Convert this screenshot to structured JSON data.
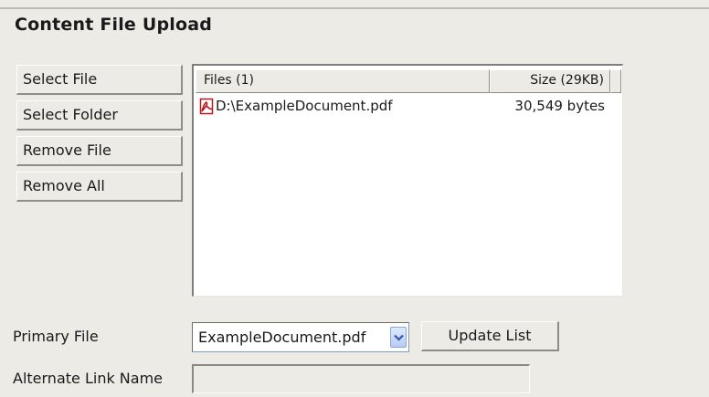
{
  "panel": {
    "title": "Content File Upload"
  },
  "sidebar": {
    "buttons": [
      {
        "label": "Select File"
      },
      {
        "label": "Select Folder"
      },
      {
        "label": "Remove File"
      },
      {
        "label": "Remove All"
      }
    ]
  },
  "file_list": {
    "columns": {
      "files": "Files (1)",
      "size": "Size (29KB)"
    },
    "rows": [
      {
        "icon": "pdf-file-icon",
        "name": "D:\\ExampleDocument.pdf",
        "size": "30,549 bytes"
      }
    ]
  },
  "form": {
    "primary_file_label": "Primary File",
    "primary_file_value": "ExampleDocument.pdf",
    "update_button_label": "Update List",
    "alternate_link_label": "Alternate Link Name",
    "alternate_link_value": ""
  },
  "colors": {
    "background": "#ecebe6",
    "list_background": "#ffffff",
    "dropdown_arrow": "#2f55b0",
    "pdf_icon": "#b8181e"
  }
}
